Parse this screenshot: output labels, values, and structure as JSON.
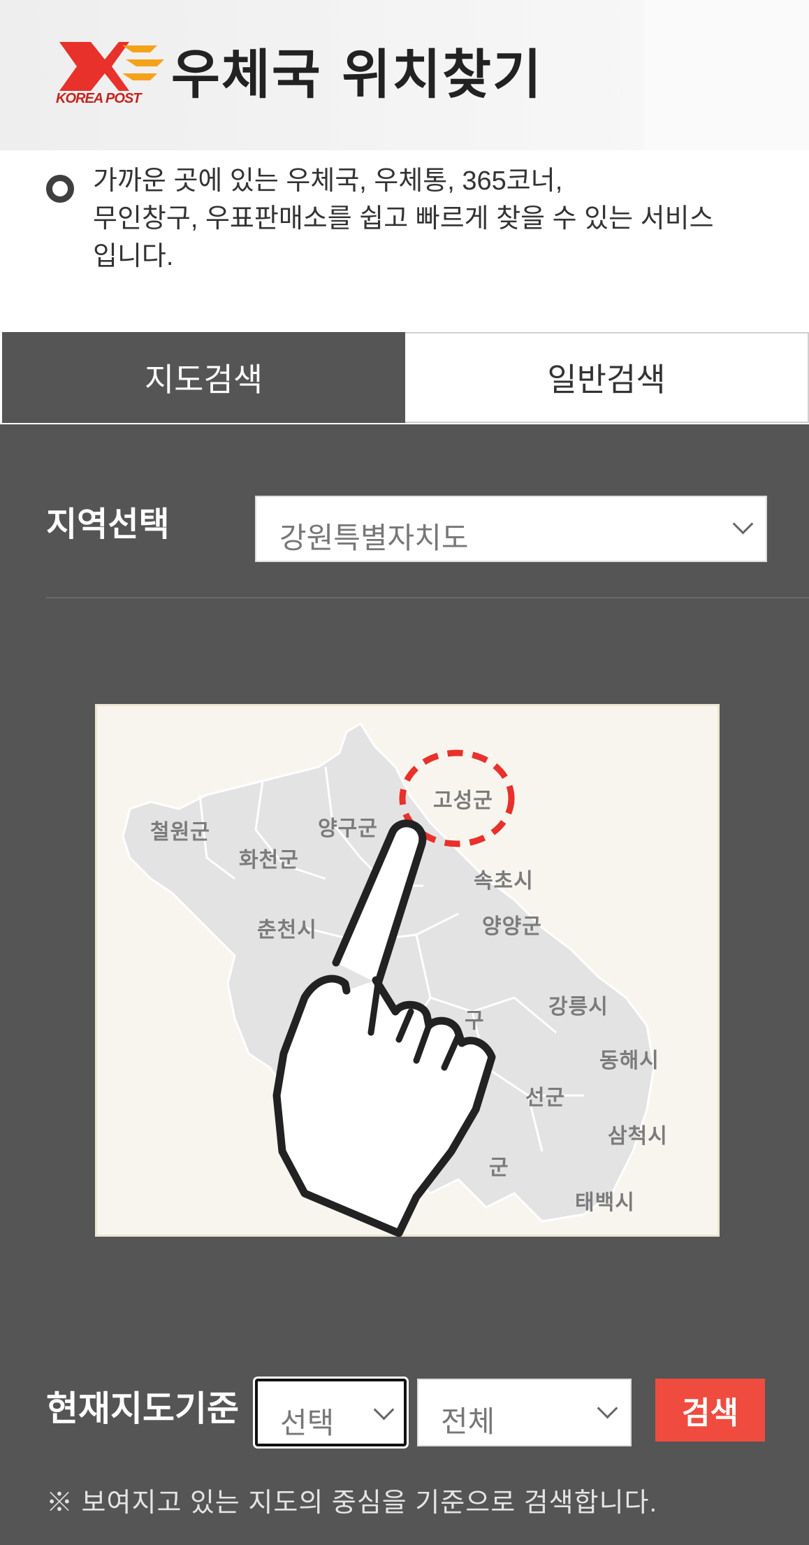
{
  "header": {
    "logo_icon": "korea-post-logo",
    "logo_text": "KOREA POST",
    "title": "우체국 위치찾기"
  },
  "intro": {
    "text": "가까운 곳에 있는 우체국, 우체통, 365코너,\n무인창구, 우표판매소를 쉽고 빠르게 찾을 수 있는 서비스\n입니다."
  },
  "tabs": [
    {
      "label": "지도검색",
      "active": true
    },
    {
      "label": "일반검색",
      "active": false
    }
  ],
  "region": {
    "label": "지역선택",
    "selected": "강원특별자치도"
  },
  "map": {
    "labels": [
      "고성군",
      "철원군",
      "양구군",
      "화천군",
      "속초시",
      "춘천시",
      "양양군",
      "강릉시",
      "동해시",
      "선군",
      "삼척시",
      "태백시",
      "구",
      "군"
    ],
    "pointer_icon": "pointing-hand-icon",
    "highlight_color": "#e8312a"
  },
  "filter": {
    "label": "현재지도기준",
    "type_selected": "선택",
    "scope_selected": "전체",
    "search_label": "검색",
    "note": "※ 보여지고 있는 지도의 중심을 기준으로 검색합니다."
  },
  "colors": {
    "panel": "#555555",
    "accent": "#ef4c3f",
    "brand_red": "#e8312a",
    "brand_orange": "#f5a21b"
  }
}
